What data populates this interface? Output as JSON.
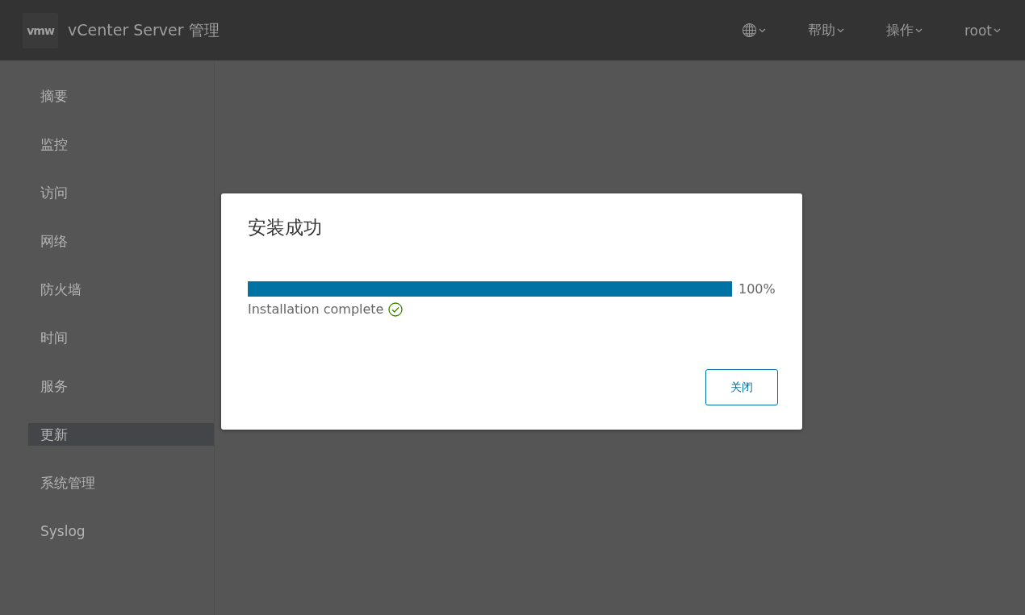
{
  "header": {
    "logo": "vmw",
    "title": "vCenter Server 管理",
    "menus": [
      {
        "kind": "globe"
      },
      {
        "kind": "text",
        "label": "帮助"
      },
      {
        "kind": "text",
        "label": "操作"
      },
      {
        "kind": "text",
        "label": "root"
      }
    ]
  },
  "sidebar": {
    "items": [
      {
        "label": "摘要",
        "selected": false
      },
      {
        "label": "监控",
        "selected": false
      },
      {
        "label": "访问",
        "selected": false
      },
      {
        "label": "网络",
        "selected": false
      },
      {
        "label": "防火墙",
        "selected": false
      },
      {
        "label": "时间",
        "selected": false
      },
      {
        "label": "服务",
        "selected": false
      },
      {
        "label": "更新",
        "selected": true
      },
      {
        "label": "系统管理",
        "selected": false
      },
      {
        "label": "Syslog",
        "selected": false
      }
    ]
  },
  "dialog": {
    "title": "安装成功",
    "progress": {
      "reading": "100%"
    },
    "status": "Installation complete",
    "button": "关闭"
  }
}
